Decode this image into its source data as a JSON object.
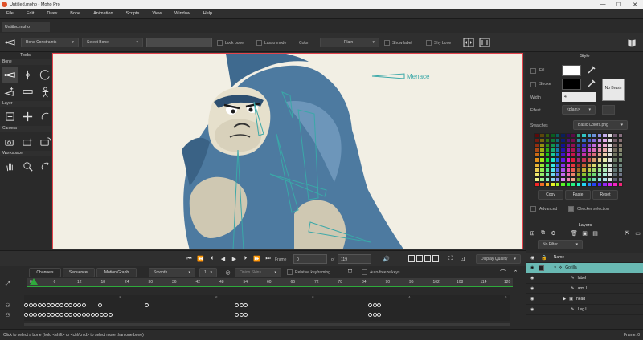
{
  "window": {
    "title": "Untitled.moho - Moho Pro",
    "minimize": "—",
    "maximize": "☐",
    "close": "✕"
  },
  "menu": [
    "File",
    "Edit",
    "Draw",
    "Bone",
    "Animation",
    "Scripts",
    "View",
    "Window",
    "Help"
  ],
  "document_tab": "Untitled.moho",
  "tool_options": {
    "bone_constraints": "Bone Constraints",
    "select_bone": "Select Bone",
    "lock_bone": "Lock bone",
    "lasso_mode": "Lasso mode",
    "color_label": "Color",
    "color_value": "Plain",
    "show_label": "Show label",
    "shy_bone": "Shy bone"
  },
  "tools_panel": {
    "title": "Tools",
    "sections": [
      "Bone",
      "Layer",
      "Camera",
      "Workspace"
    ]
  },
  "canvas": {
    "annotation": "Menace"
  },
  "style_panel": {
    "title": "Style",
    "fill_label": "Fill",
    "stroke_label": "Stroke",
    "width_label": "Width",
    "width_value": "4",
    "effect_label": "Effect",
    "effect_value": "<plain>",
    "no_brush": "No Brush",
    "swatches_label": "Swatches",
    "swatches_value": "Basic Colors.png",
    "copy": "Copy",
    "paste": "Paste",
    "reset": "Reset",
    "advanced": "Advanced",
    "checker_selection": "Checker selection",
    "fill_color": "#ffffff",
    "stroke_color": "#000000"
  },
  "layers_panel": {
    "title": "Layers",
    "filter": "No Filter",
    "name_header": "Name",
    "layers": [
      {
        "name": "Gorilla",
        "selected": true
      },
      {
        "name": "label",
        "selected": false
      },
      {
        "name": "arm L",
        "selected": false
      },
      {
        "name": "head",
        "selected": false
      },
      {
        "name": "Leg L",
        "selected": false
      }
    ]
  },
  "playback": {
    "frame_label": "Frame",
    "frame_value": "0",
    "of_label": "of",
    "total_frames": "119",
    "display_quality": "Display Quality"
  },
  "timeline": {
    "tabs": [
      "Channels",
      "Sequencer",
      "Motion Graph"
    ],
    "interpolation": "Smooth",
    "step": "1",
    "onion_skins": "Onion Skins",
    "relative_keyframing": "Relative keyframing",
    "auto_freeze_keys": "Auto-freeze keys",
    "ruler": [
      "0",
      "6",
      "12",
      "18",
      "24",
      "30",
      "36",
      "42",
      "48",
      "54",
      "60",
      "66",
      "72",
      "78",
      "84",
      "90",
      "96",
      "102",
      "108",
      "114",
      "120"
    ],
    "markers": [
      "1",
      "2",
      "3",
      "4",
      "5"
    ]
  },
  "status": {
    "message": "Click to select a bone (hold <shift> or <ctrl/cmd> to select more than one bone)",
    "frame": "Frame: 0"
  },
  "colors": {
    "accent": "#3aa8a8",
    "canvas_border": "#e3434c",
    "gorilla_fur": "#4d7aa0",
    "timeline_green": "#2faa3c",
    "selected_layer": "#69b9b3"
  }
}
